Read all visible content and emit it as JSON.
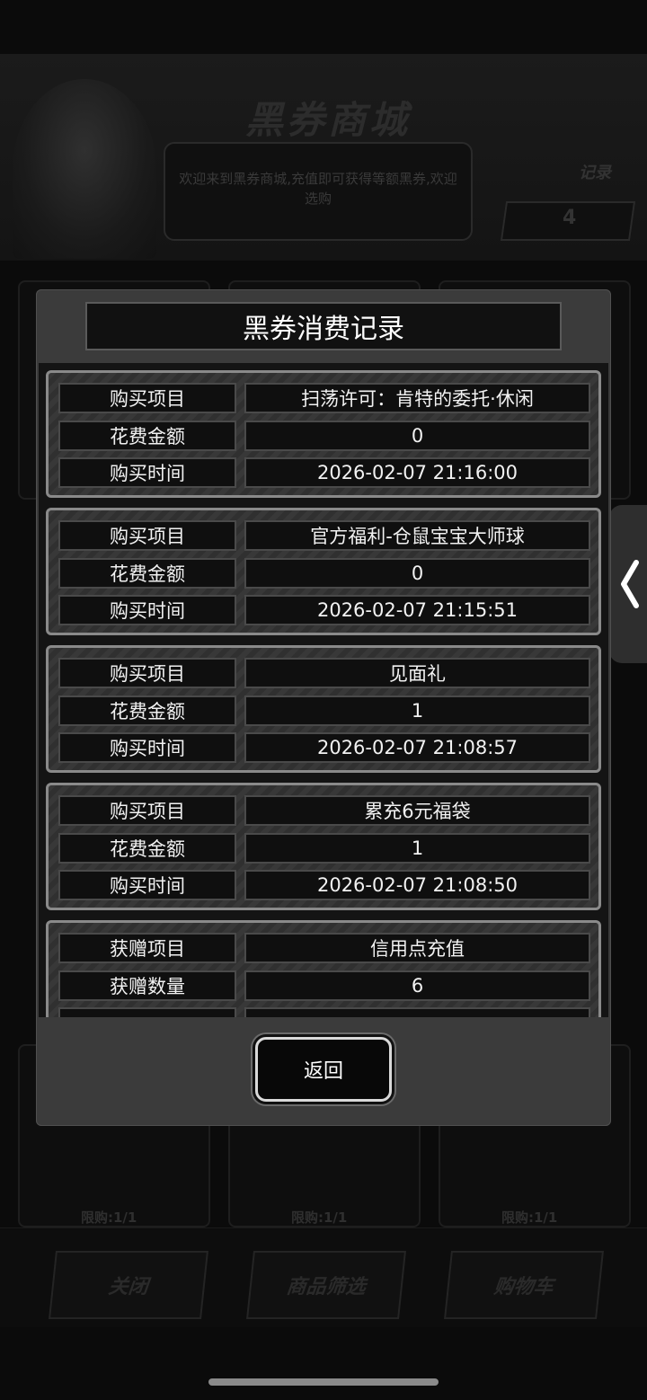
{
  "background": {
    "shop_title": "黑券商城",
    "welcome_text": "欢迎来到黑券商城,充值即可获得等额黑券,欢迎选购",
    "record_label": "记录",
    "coupon_count": "4",
    "item_limits": [
      "限购:1/1",
      "限购:1/1",
      "限购:1/1"
    ],
    "footer_buttons": [
      "关闭",
      "商品筛选",
      "购物车"
    ]
  },
  "modal": {
    "title": "黑券消费记录",
    "back_label": "返回",
    "records": [
      {
        "rows": [
          {
            "label": "购买项目",
            "value": "扫荡许可：肯特的委托·休闲"
          },
          {
            "label": "花费金额",
            "value": "0"
          },
          {
            "label": "购买时间",
            "value": "2026-02-07 21:16:00"
          }
        ]
      },
      {
        "rows": [
          {
            "label": "购买项目",
            "value": "官方福利-仓鼠宝宝大师球"
          },
          {
            "label": "花费金额",
            "value": "0"
          },
          {
            "label": "购买时间",
            "value": "2026-02-07 21:15:51"
          }
        ]
      },
      {
        "rows": [
          {
            "label": "购买项目",
            "value": "见面礼"
          },
          {
            "label": "花费金额",
            "value": "1"
          },
          {
            "label": "购买时间",
            "value": "2026-02-07 21:08:57"
          }
        ]
      },
      {
        "rows": [
          {
            "label": "购买项目",
            "value": "累充6元福袋"
          },
          {
            "label": "花费金额",
            "value": "1"
          },
          {
            "label": "购买时间",
            "value": "2026-02-07 21:08:50"
          }
        ]
      },
      {
        "rows": [
          {
            "label": "获赠项目",
            "value": "信用点充值"
          },
          {
            "label": "获赠数量",
            "value": "6"
          }
        ]
      }
    ]
  }
}
